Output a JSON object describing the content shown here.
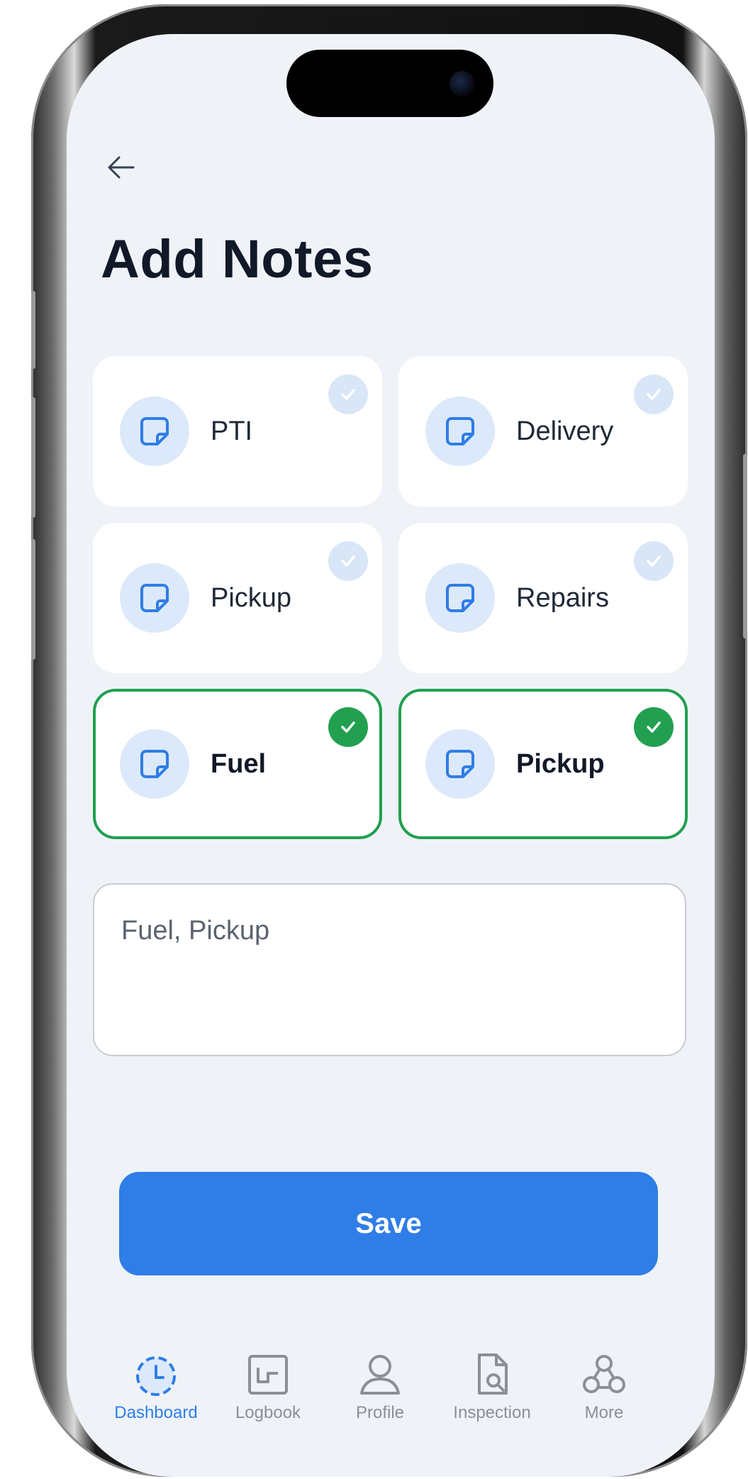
{
  "header": {
    "title": "Add Notes"
  },
  "categories": [
    {
      "label": "PTI",
      "selected": false
    },
    {
      "label": "Delivery",
      "selected": false
    },
    {
      "label": "Pickup",
      "selected": false
    },
    {
      "label": "Repairs",
      "selected": false
    },
    {
      "label": "Fuel",
      "selected": true
    },
    {
      "label": "Pickup",
      "selected": true
    }
  ],
  "notes": {
    "value": "Fuel, Pickup"
  },
  "save_button": {
    "label": "Save"
  },
  "tabbar": {
    "items": [
      {
        "label": "Dashboard",
        "icon": "dashboard-clock-icon",
        "active": true
      },
      {
        "label": "Logbook",
        "icon": "logbook-icon",
        "active": false
      },
      {
        "label": "Profile",
        "icon": "profile-icon",
        "active": false
      },
      {
        "label": "Inspection",
        "icon": "inspection-icon",
        "active": false
      },
      {
        "label": "More",
        "icon": "more-icon",
        "active": false
      }
    ]
  },
  "colors": {
    "accent": "#2f7de6",
    "selected_border": "#22a050",
    "background": "#eff3f8"
  }
}
